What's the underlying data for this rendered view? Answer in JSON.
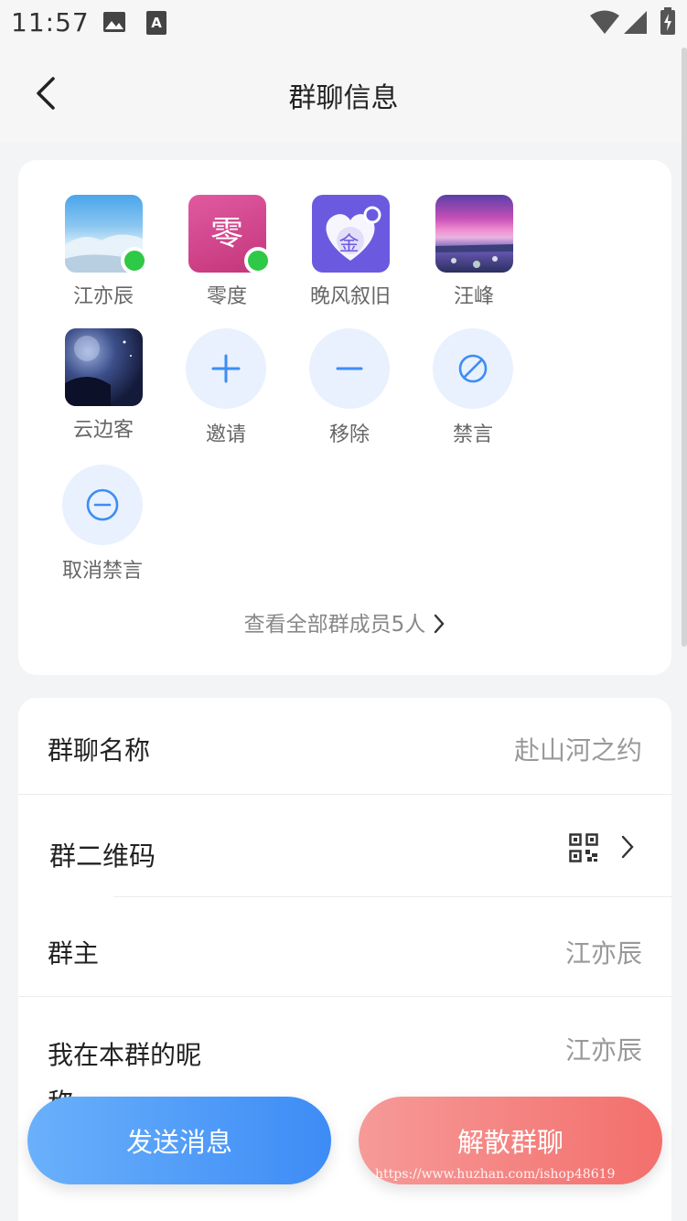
{
  "status_bar": {
    "time": "11:57"
  },
  "header": {
    "title": "群聊信息"
  },
  "members": [
    {
      "name": "江亦辰",
      "online": true,
      "avatar": "sky-photo"
    },
    {
      "name": "零度",
      "online": true,
      "avatar": "text-avatar",
      "avatar_text": "零",
      "avatar_color": "#d6468f"
    },
    {
      "name": "晚风叙旧",
      "online": false,
      "avatar": "gold-heart-icon",
      "avatar_text": "金",
      "avatar_color": "#6b5ae0"
    },
    {
      "name": "汪峰",
      "online": false,
      "avatar": "sunset-lake-photo"
    },
    {
      "name": "云边客",
      "online": false,
      "avatar": "night-tree-photo"
    }
  ],
  "actions": {
    "invite": "邀请",
    "remove": "移除",
    "mute": "禁言",
    "unmute": "取消禁言"
  },
  "view_all": "查看全部群成员5人",
  "settings": {
    "group_name_label": "群聊名称",
    "group_name_value": "赴山河之约",
    "qr_label": "群二维码",
    "owner_label": "群主",
    "owner_value": "江亦辰",
    "nickname_label": "我在本群的昵称",
    "nickname_value": "江亦辰"
  },
  "buttons": {
    "send": "发送消息",
    "dissolve": "解散群聊"
  },
  "watermark": "https://www.huzhan.com/ishop48619",
  "colors": {
    "accent_blue": "#3d8cf6",
    "accent_red": "#f36f6c",
    "online": "#2ec946"
  }
}
